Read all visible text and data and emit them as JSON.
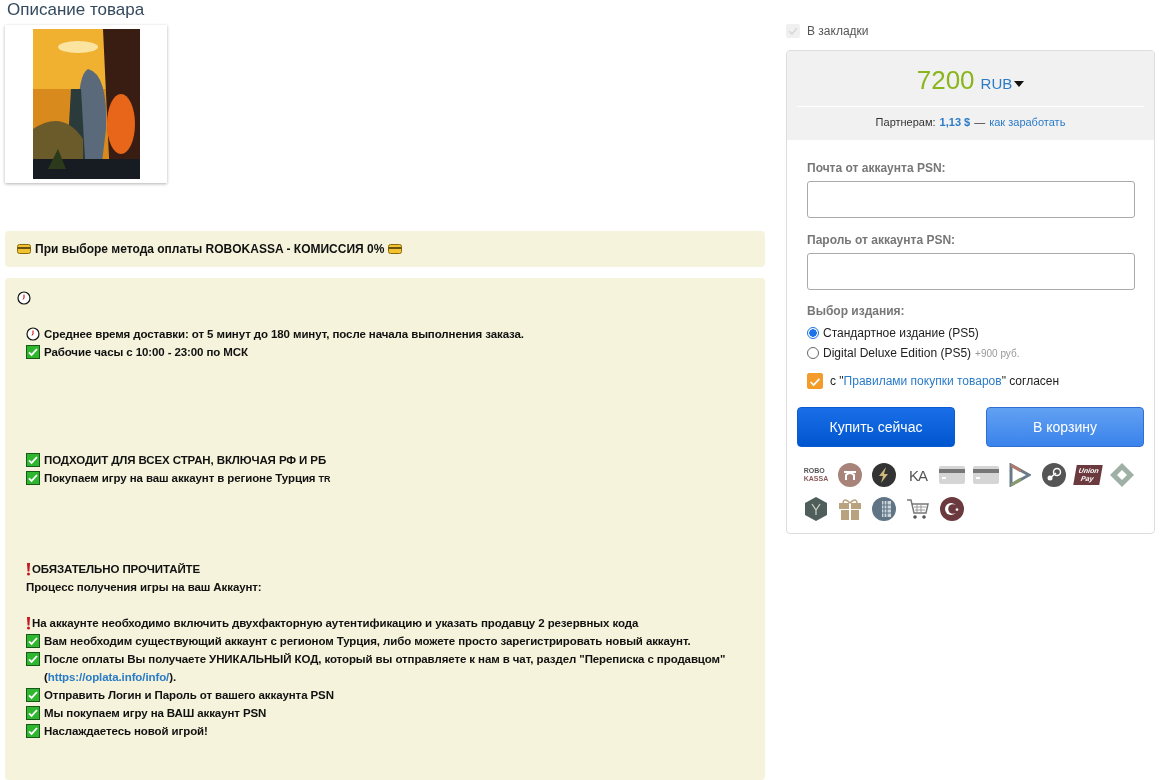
{
  "heading": "Описание товара",
  "notice": {
    "kind": "card-framed",
    "text": "При выборе метода оплаты ROBOKASSA - КОМИССИЯ 0%"
  },
  "description": {
    "header": {
      "kind": "clock"
    },
    "lines": [
      {
        "kind": "empty"
      },
      {
        "kind": "clock",
        "text": "Среднее время доставки: от 5 минут до 180 минут, после начала выполнения заказа."
      },
      {
        "kind": "check",
        "text": "Рабочие часы с 10:00 - 23:00 по МСК"
      },
      {
        "kind": "empty"
      },
      {
        "kind": "empty"
      },
      {
        "kind": "empty"
      },
      {
        "kind": "empty"
      },
      {
        "kind": "empty"
      },
      {
        "kind": "check",
        "text": "ПОДХОДИТ ДЛЯ ВСЕХ СТРАН, ВКЛЮЧАЯ РФ И РБ"
      },
      {
        "kind": "check",
        "text": "Покупаем игру на ваш аккаунт в регионе Турция",
        "suffix": "TR"
      },
      {
        "kind": "empty"
      },
      {
        "kind": "empty"
      },
      {
        "kind": "empty"
      },
      {
        "kind": "empty"
      },
      {
        "kind": "exclaim",
        "text": "ОБЯЗАТЕЛЬНО ПРОЧИТАЙТЕ"
      },
      {
        "kind": "plain",
        "text": "Процесс получения игры на ваш Аккаунт:"
      },
      {
        "kind": "empty"
      },
      {
        "kind": "exclaim",
        "text": "На аккаунте необходимо включить двухфакторную аутентификацию и указать продавцу 2 резервных кода"
      },
      {
        "kind": "check",
        "text": "Вам необходим существующий аккаунт с регионом Турция, либо можете просто зарегистрировать новый аккаунт."
      },
      {
        "kind": "check",
        "text": "После оплаты Вы получаете УНИКАЛЬНЫЙ КОД, который вы отправляете к нам в чат, раздел \"Переписка с продавцом\" (",
        "link": "https://oplata.info/info/",
        "after": ")."
      },
      {
        "kind": "check",
        "text": "Отправить Логин и Пароль от вашего аккаунта PSN"
      },
      {
        "kind": "check",
        "text": "Мы покупаем игру на ВАШ аккаунт PSN"
      },
      {
        "kind": "check",
        "text": "Наслаждаетесь новой игрой!"
      }
    ]
  },
  "bookmark": {
    "label": "В закладки",
    "checked": true
  },
  "price": {
    "amount": "7200",
    "currency": "RUB"
  },
  "partners": {
    "label": "Партнерам:",
    "amount": "1,13 $",
    "dash": "—",
    "link": "как заработать"
  },
  "fields": [
    {
      "label": "Почта от аккаунта PSN:"
    },
    {
      "label": "Пароль от аккаунта PSN:"
    }
  ],
  "edition": {
    "label": "Выбор издания:",
    "options": [
      {
        "label": "Стандартное издание (PS5)",
        "selected": true
      },
      {
        "label": "Digital Deluxe Edition (PS5)",
        "extra": "+900 руб.",
        "selected": false
      }
    ]
  },
  "agree": {
    "checked": true,
    "before": "с \"",
    "link": "Правилами покупки товаров",
    "after": "\" согласен"
  },
  "buttons": [
    {
      "label": "Купить сейчас",
      "kind": "primary"
    },
    {
      "label": "В корзину",
      "kind": "secondary"
    }
  ],
  "payment_methods": [
    {
      "kind": "text-logo",
      "lines": [
        "ROBO",
        "KASSA"
      ]
    },
    {
      "kind": "arch"
    },
    {
      "kind": "bolt"
    },
    {
      "kind": "letters",
      "label": "KA"
    },
    {
      "kind": "card"
    },
    {
      "kind": "card"
    },
    {
      "kind": "arrows"
    },
    {
      "kind": "steam"
    },
    {
      "kind": "union",
      "lines": [
        "Union",
        "Pay"
      ]
    },
    {
      "kind": "diamond"
    },
    {
      "kind": "hexagon"
    },
    {
      "kind": "gift"
    },
    {
      "kind": "globe"
    },
    {
      "kind": "cart"
    },
    {
      "kind": "crescent"
    }
  ]
}
